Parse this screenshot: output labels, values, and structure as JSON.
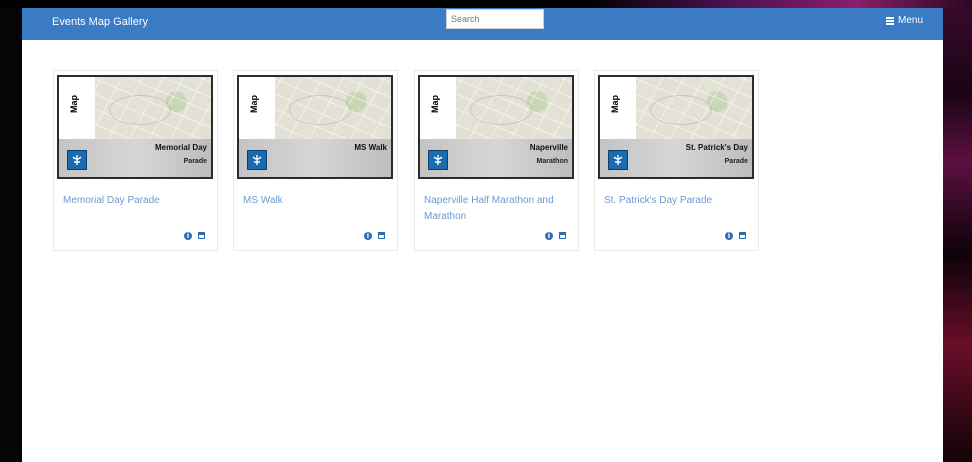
{
  "header": {
    "title": "Events Map Gallery",
    "search_placeholder": "Search",
    "menu_label": "Menu"
  },
  "colors": {
    "header_bg": "#3b7bc4",
    "link": "#6d9ad0",
    "icon": "#2c6fb5"
  },
  "gallery": {
    "items": [
      {
        "thumb_label": "Map",
        "thumb_title": "Memorial Day",
        "thumb_subtitle": "Parade",
        "title": "Memorial Day Parade"
      },
      {
        "thumb_label": "Map",
        "thumb_title": "MS Walk",
        "thumb_subtitle": "",
        "title": "MS Walk"
      },
      {
        "thumb_label": "Map",
        "thumb_title": "Naperville",
        "thumb_subtitle": "Marathon",
        "title": "Naperville Half Marathon and Marathon"
      },
      {
        "thumb_label": "Map",
        "thumb_title": "St. Patrick's Day",
        "thumb_subtitle": "Parade",
        "title": "St. Patrick's Day Parade"
      }
    ],
    "item_icons": [
      "info-icon",
      "open-window-icon"
    ]
  }
}
